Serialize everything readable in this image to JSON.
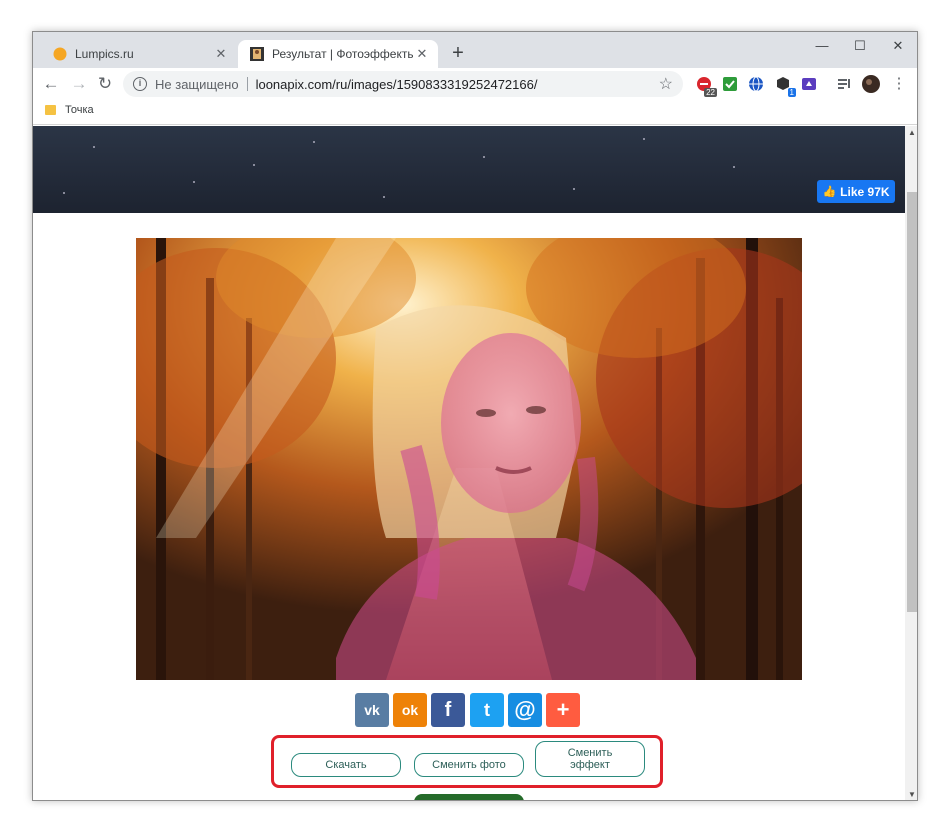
{
  "browser": {
    "tabs": [
      {
        "title": "Lumpics.ru",
        "active": false
      },
      {
        "title": "Результат | Фотоэффекты онлайн",
        "active": true
      }
    ],
    "new_tab": "+",
    "window_controls": {
      "minimize": "—",
      "maximize": "☐",
      "close": "✕"
    },
    "toolbar": {
      "back": "←",
      "forward": "→",
      "reload": "↻",
      "security_label": "Не защищено",
      "url": "loonapix.com/ru/images/1590833319252472166/",
      "star": "☆",
      "extension_badges": {
        "ext1": "22",
        "ext4": "1"
      }
    },
    "bookmarks": [
      {
        "label": "Точка"
      }
    ]
  },
  "page": {
    "fb_like": "Like 97K",
    "share": {
      "vk": "vk",
      "ok": "ok",
      "fb": "f",
      "tw": "t",
      "mail": "@",
      "more": "+"
    },
    "buttons": {
      "download": "Скачать",
      "change_photo": "Сменить фото",
      "change_effect": "Сменить эффект"
    }
  },
  "colors": {
    "accent_highlight": "#e0202a",
    "vk": "#597da3",
    "ok": "#ee8208",
    "fb": "#3b5998",
    "tw": "#1da1f2",
    "mail": "#168de2",
    "more": "#ff5c40"
  }
}
